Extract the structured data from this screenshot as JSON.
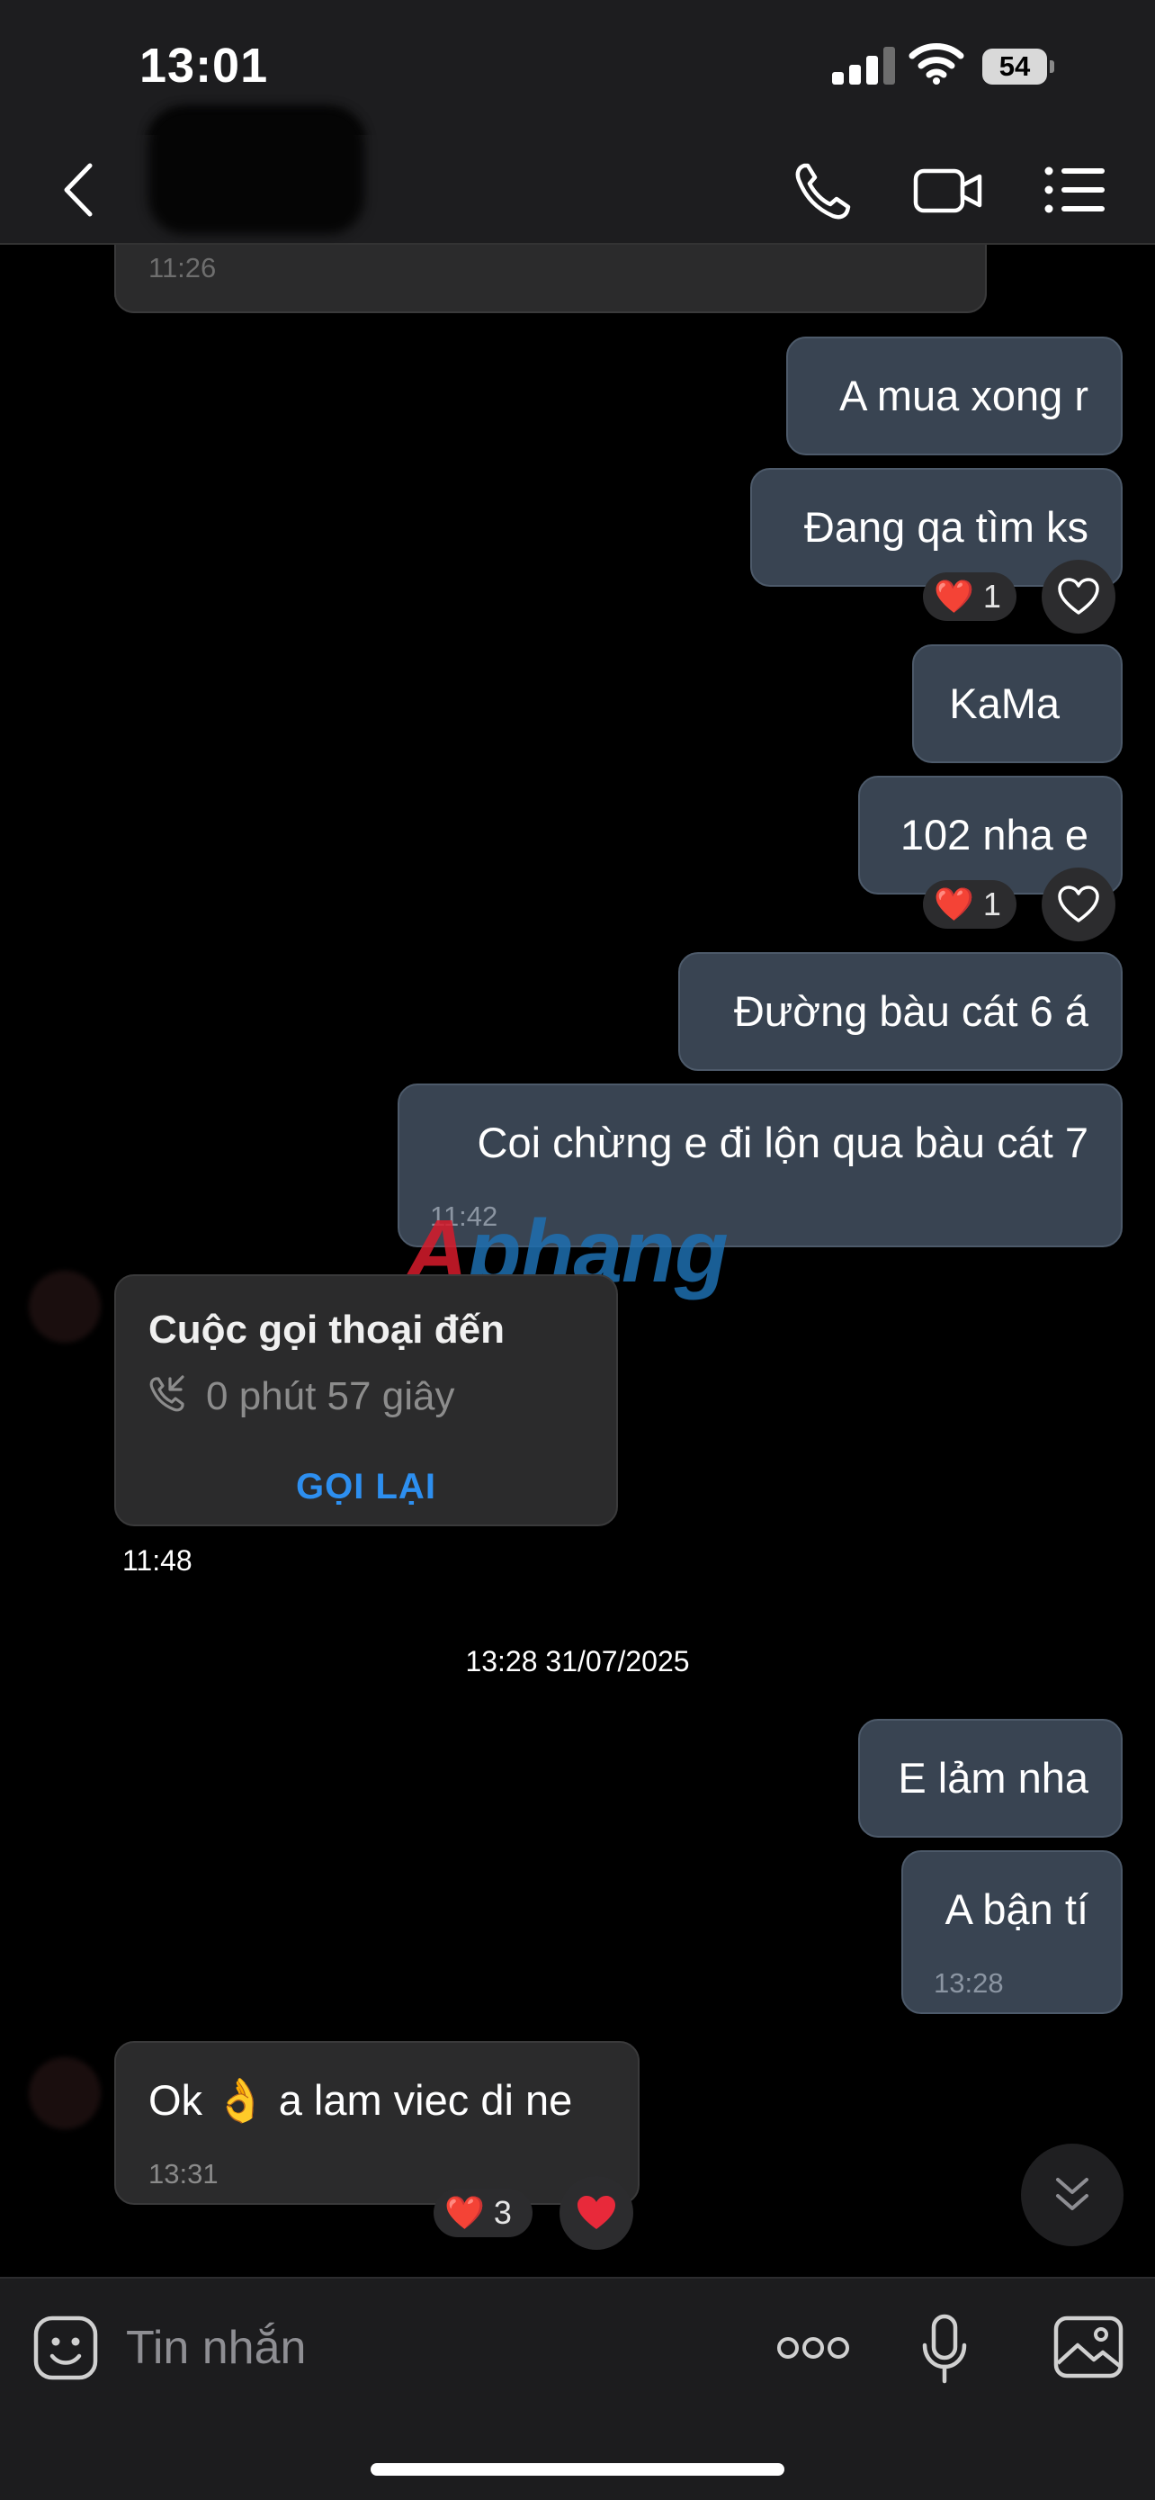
{
  "status_bar": {
    "time": "13:01",
    "battery": "54",
    "icons": [
      "cellular-signal-icon",
      "wifi-icon",
      "battery-icon"
    ]
  },
  "nav": {
    "icons": [
      "back-chevron-icon",
      "phone-call-icon",
      "video-call-icon",
      "menu-list-icon"
    ]
  },
  "messages": [
    {
      "side": "in",
      "time": "11:26"
    },
    {
      "side": "out",
      "text": "A mua xong r"
    },
    {
      "side": "out",
      "text": "Đang qa tìm ks",
      "reaction_count": "1"
    },
    {
      "side": "out",
      "text": "KaMa"
    },
    {
      "side": "out",
      "text": "102 nha e",
      "reaction_count": "1"
    },
    {
      "side": "out",
      "text": "Đường bàu cát 6 á"
    },
    {
      "side": "out",
      "text": "Coi chừng e đi lộn qua bàu cát 7",
      "time": "11:42"
    },
    {
      "side": "in",
      "type": "call",
      "title": "Cuộc gọi thoại đến",
      "duration": "0 phút 57 giây",
      "action": "GỌI LẠI",
      "time": "11:48"
    },
    {
      "side": "out",
      "text": "E lảm nha"
    },
    {
      "side": "out",
      "text": "A bận tí",
      "time": "13:28"
    },
    {
      "side": "in",
      "text": "Ok 👌 a lam viec di ne",
      "time": "13:31",
      "reaction_count": "3"
    }
  ],
  "date_separator": "13:28 31/07/2025",
  "watermark": {
    "first": "A",
    "rest": "phang"
  },
  "input": {
    "placeholder": "Tin nhắn"
  },
  "colors": {
    "outgoing_bubble": "#394452",
    "incoming_bubble": "#2b2b2c",
    "accent": "#2d8ff0",
    "reaction_heart": "#e8293a"
  }
}
